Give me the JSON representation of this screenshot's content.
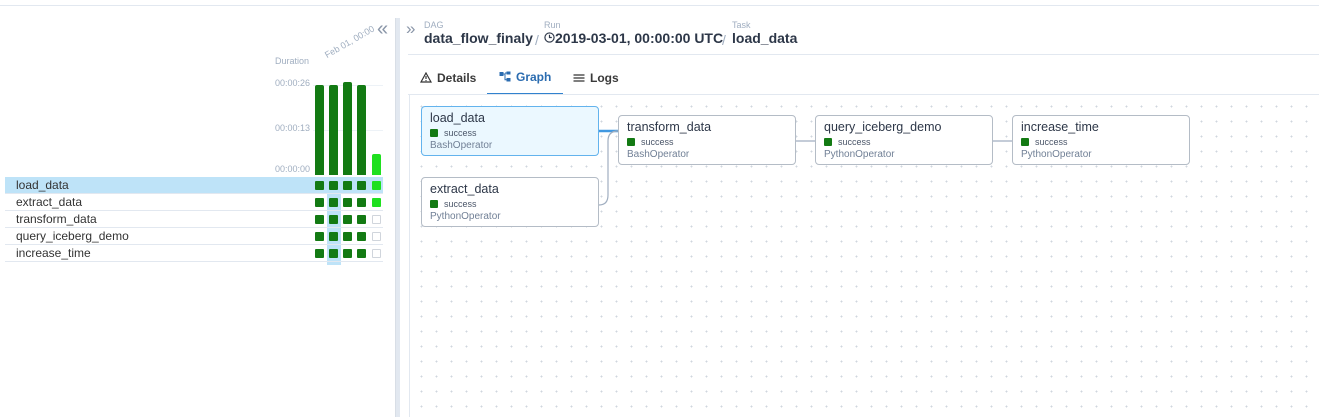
{
  "grid": {
    "collapse_glyph": "«",
    "duration_label": "Duration",
    "date_label": "Feb 01, 00:00",
    "ticks": [
      "00:00:26",
      "00:00:13",
      "00:00:00"
    ],
    "runs": [
      {
        "duration_seconds": 26,
        "state": "success"
      },
      {
        "duration_seconds": 26,
        "state": "success"
      },
      {
        "duration_seconds": 27,
        "state": "success"
      },
      {
        "duration_seconds": 26,
        "state": "success"
      },
      {
        "duration_seconds": 6,
        "state": "running"
      }
    ],
    "tasks": [
      {
        "name": "load_data",
        "states": [
          "success",
          "success",
          "success",
          "success",
          "running"
        ],
        "selected": true
      },
      {
        "name": "extract_data",
        "states": [
          "success",
          "success",
          "success",
          "success",
          "running"
        ],
        "selected": false
      },
      {
        "name": "transform_data",
        "states": [
          "success",
          "success",
          "success",
          "success",
          "none"
        ],
        "selected": false
      },
      {
        "name": "query_iceberg_demo",
        "states": [
          "success",
          "success",
          "success",
          "success",
          "none"
        ],
        "selected": false
      },
      {
        "name": "increase_time",
        "states": [
          "success",
          "success",
          "success",
          "success",
          "none"
        ],
        "selected": false
      }
    ]
  },
  "breadcrumb": {
    "expand_glyph": "»",
    "dag_caption": "DAG",
    "dag_value": "data_flow_finaly",
    "run_caption": "Run",
    "run_value": "2019-03-01, 00:00:00 UTC",
    "task_caption": "Task",
    "task_value": "load_data",
    "separator": "/"
  },
  "tabs": {
    "details": "Details",
    "graph": "Graph",
    "logs": "Logs",
    "active": "graph"
  },
  "graph": {
    "nodes": {
      "load_data": {
        "name": "load_data",
        "status": "success",
        "operator": "BashOperator"
      },
      "extract_data": {
        "name": "extract_data",
        "status": "success",
        "operator": "PythonOperator"
      },
      "transform_data": {
        "name": "transform_data",
        "status": "success",
        "operator": "BashOperator"
      },
      "query_iceberg_demo": {
        "name": "query_iceberg_demo",
        "status": "success",
        "operator": "PythonOperator"
      },
      "increase_time": {
        "name": "increase_time",
        "status": "success",
        "operator": "PythonOperator"
      }
    },
    "edges": [
      [
        "load_data",
        "transform_data"
      ],
      [
        "extract_data",
        "transform_data"
      ],
      [
        "transform_data",
        "query_iceberg_demo"
      ],
      [
        "query_iceberg_demo",
        "increase_time"
      ]
    ]
  },
  "colors": {
    "success": "#137a13",
    "running": "#1fe01f",
    "selected_bg": "#bee3f8",
    "accent": "#3182ce"
  }
}
